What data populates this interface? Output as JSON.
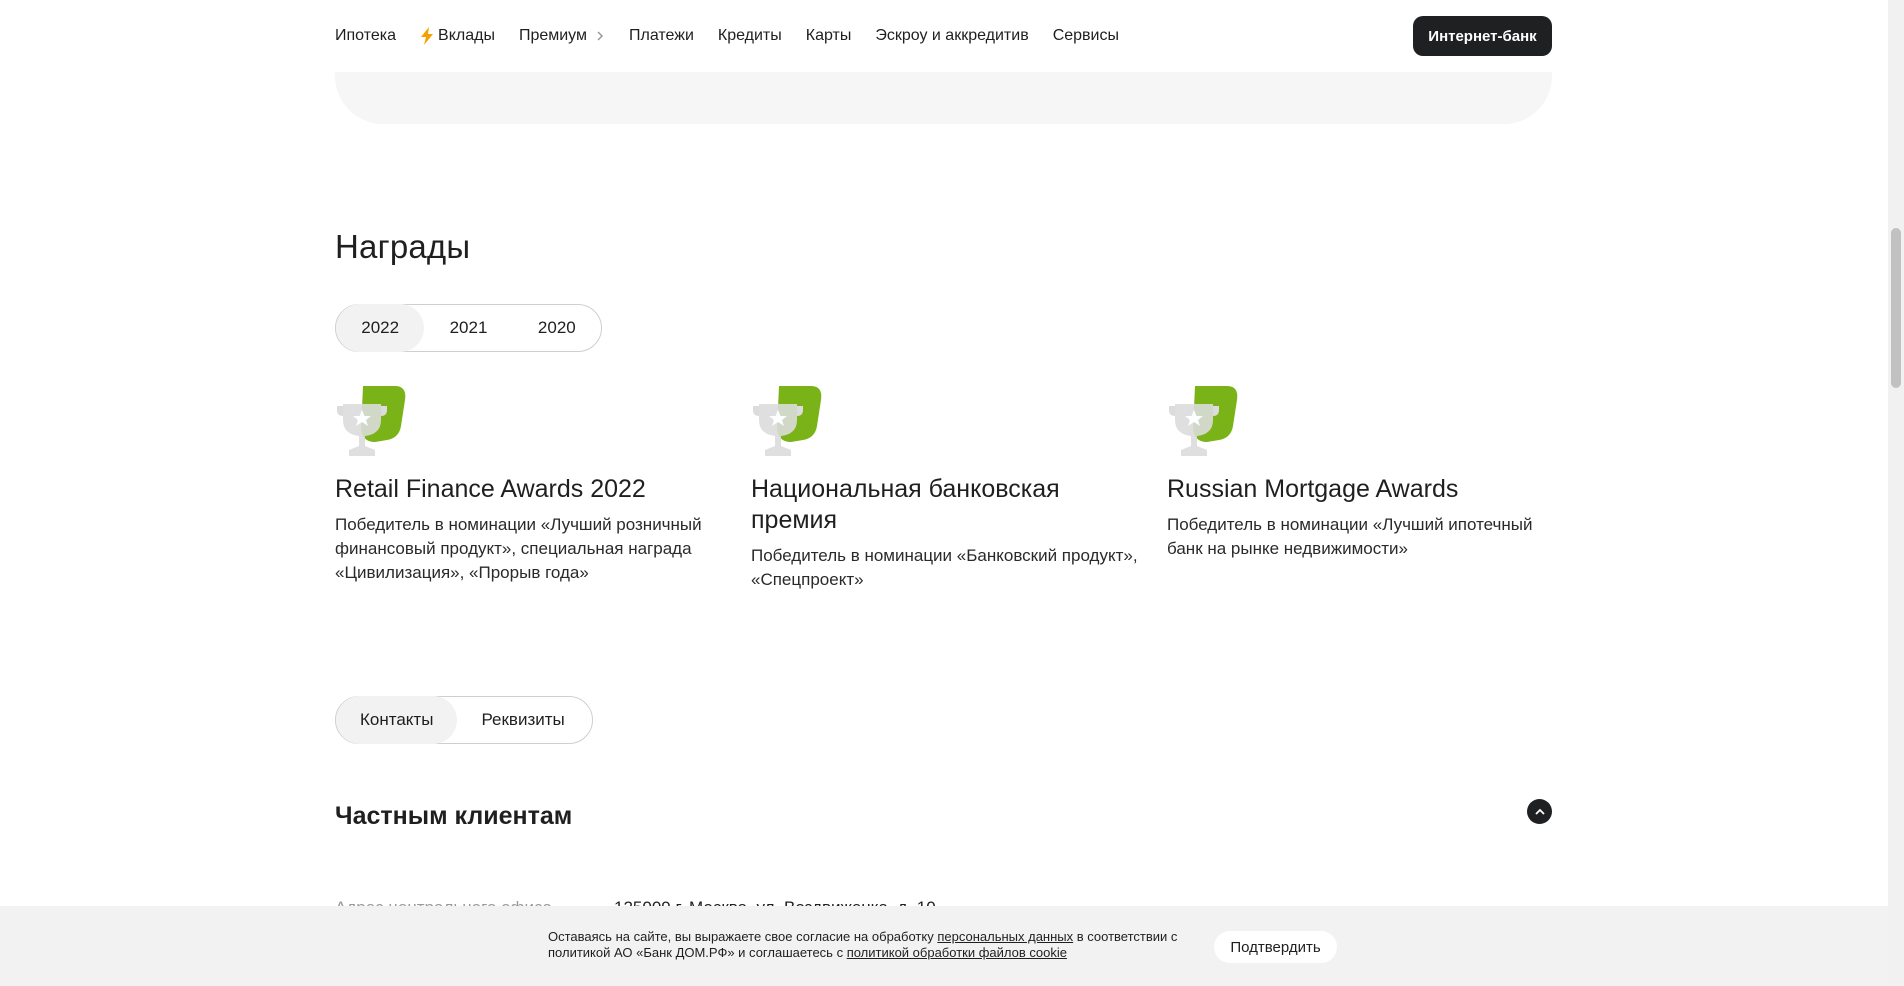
{
  "header": {
    "nav": [
      {
        "label": "Ипотека",
        "icon": null
      },
      {
        "label": "Вклады",
        "icon": "bolt-icon"
      },
      {
        "label": "Премиум",
        "icon": "chevron-right-icon"
      },
      {
        "label": "Платежи",
        "icon": null
      },
      {
        "label": "Кредиты",
        "icon": null
      },
      {
        "label": "Карты",
        "icon": null
      },
      {
        "label": "Эскроу и аккредитив",
        "icon": null
      },
      {
        "label": "Сервисы",
        "icon": null
      }
    ],
    "ibank_label": "Интернет-банк"
  },
  "awards": {
    "title": "Награды",
    "years": [
      "2022",
      "2021",
      "2020"
    ],
    "active_year": "2022",
    "items": [
      {
        "title": "Retail Finance Awards 2022",
        "desc": "Победитель в номинации «Лучший розничный финансовый продукт», специальная награда «Цивилизация», «Прорыв года»"
      },
      {
        "title": "Национальная банковская премия",
        "desc": "Победитель в номинации «Банковский продукт», «Спецпроект»"
      },
      {
        "title": "Russian Mortgage Awards",
        "desc": "Победитель в номинации «Лучший ипотечный банк на рынке недвижимости»"
      }
    ]
  },
  "contacts": {
    "tabs": [
      "Контакты",
      "Реквизиты"
    ],
    "active_tab": "Контакты",
    "section_title": "Частным клиентам",
    "address_label": "Адрес центрального офиса",
    "address_value": "125009 г. Москва, ул. Воздвиженка, д. 10"
  },
  "cookie": {
    "text_1": "Оставаясь на сайте, вы выражаете свое согласие на обработку ",
    "link_1": "персональных данных",
    "text_2": " в соответствии с политикой АО «Банк ДОМ.РФ» и соглашаетесь с ",
    "link_2": "политикой обработки файлов cookie",
    "confirm_label": "Подтвердить"
  },
  "colors": {
    "accent_green": "#7ab317",
    "dark": "#1f2022"
  }
}
